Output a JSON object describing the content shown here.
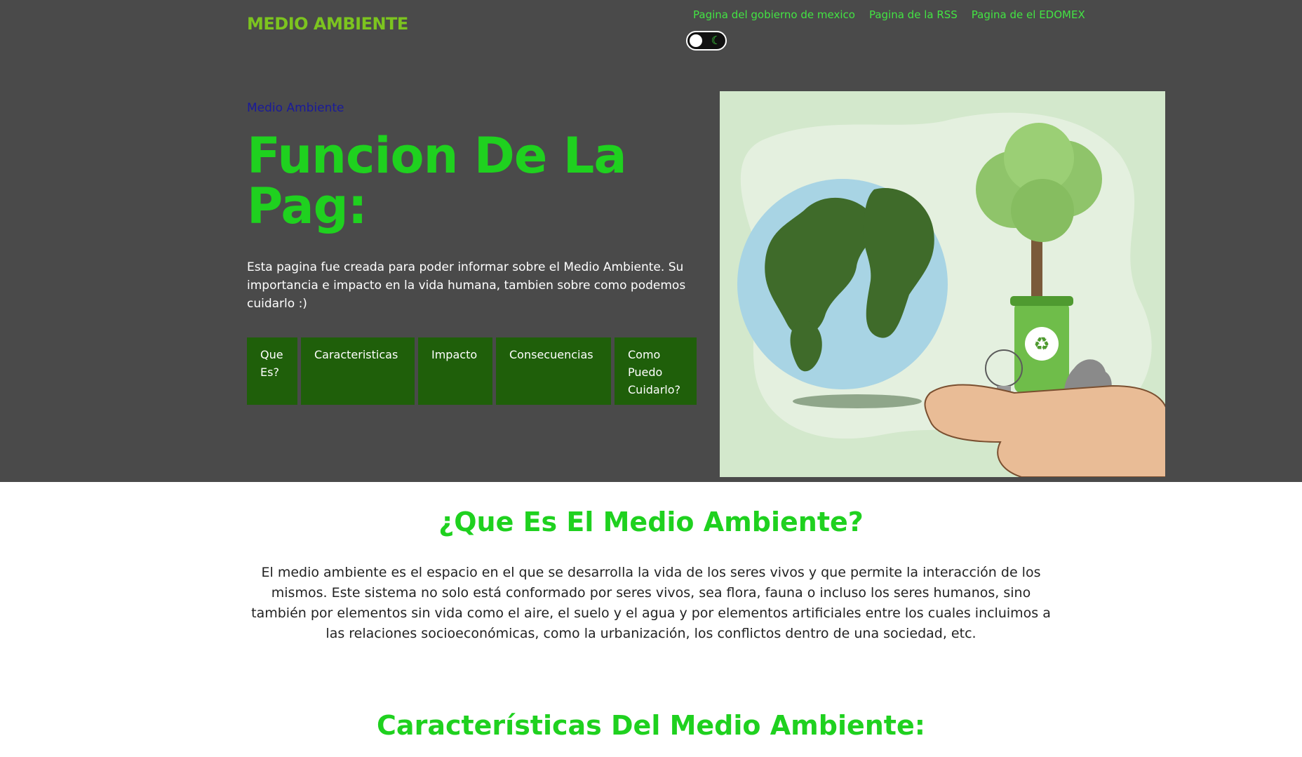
{
  "header": {
    "brand": "MEDIO AMBIENTE",
    "links": [
      "Pagina del gobierno de mexico",
      "Pagina de la RSS",
      "Pagina de el EDOMEX"
    ],
    "theme_toggle_icon": "moon-icon"
  },
  "hero": {
    "kicker": "Medio Ambiente",
    "title": "Funcion De La Pag:",
    "text": "Esta pagina fue creada para poder informar sobre el Medio Ambiente. Su importancia e impacto en la vida humana, tambien sobre como podemos cuidarlo :)",
    "buttons": [
      "Que Es?",
      "Caracteristicas",
      "Impacto",
      "Consecuencias",
      "Como Puedo Cuidarlo?"
    ],
    "illustration_icon": "earth-tree-recycling-illustration"
  },
  "sections": [
    {
      "title": "¿Que Es El Medio Ambiente?",
      "body": "El medio ambiente es el espacio en el que se desarrolla la vida de los seres vivos y que permite la interacción de los mismos. Este sistema no solo está conformado por seres vivos, sea flora, fauna o incluso los seres humanos, sino también por elementos sin vida como el aire, el suelo y el agua y por elementos artificiales entre los cuales incluimos a las relaciones socioeconómicas, como la urbanización, los conflictos dentro de una sociedad, etc."
    },
    {
      "title": "Características Del Medio Ambiente:"
    }
  ],
  "colors": {
    "hero_bg": "#4a4a4a",
    "brand": "#7cc41f",
    "accent_green": "#1fd11f",
    "button_bg": "#1f5f0a",
    "link": "#43e443",
    "kicker": "#1a1a9a"
  }
}
